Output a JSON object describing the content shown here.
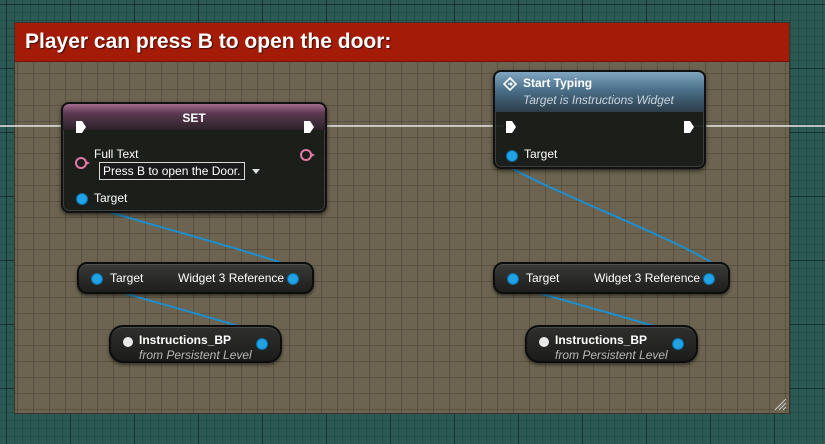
{
  "comment": {
    "title": "Player can press B to open the door:",
    "header_color": "#a41b07"
  },
  "set_node": {
    "title": "SET",
    "full_text_label": "Full Text",
    "full_text_value": "Press B to open the Door.",
    "target_label": "Target"
  },
  "start_typing_node": {
    "title": "Start Typing",
    "subtitle": "Target is Instructions Widget",
    "target_label": "Target",
    "icon": "function-icon"
  },
  "getter_left": {
    "target_label": "Target",
    "output_label": "Widget 3 Reference"
  },
  "getter_right": {
    "target_label": "Target",
    "output_label": "Widget 3 Reference"
  },
  "var_left": {
    "title": "Instructions_BP",
    "subtitle": "from Persistent Level"
  },
  "var_right": {
    "title": "Instructions_BP",
    "subtitle": "from Persistent Level"
  },
  "colors": {
    "object_pin": "#20a3e6",
    "text_pin": "#e07aa4",
    "exec_wire": "#ffffff",
    "grid_bg": "#2b5a55",
    "comment_bg": "#6c6450"
  }
}
